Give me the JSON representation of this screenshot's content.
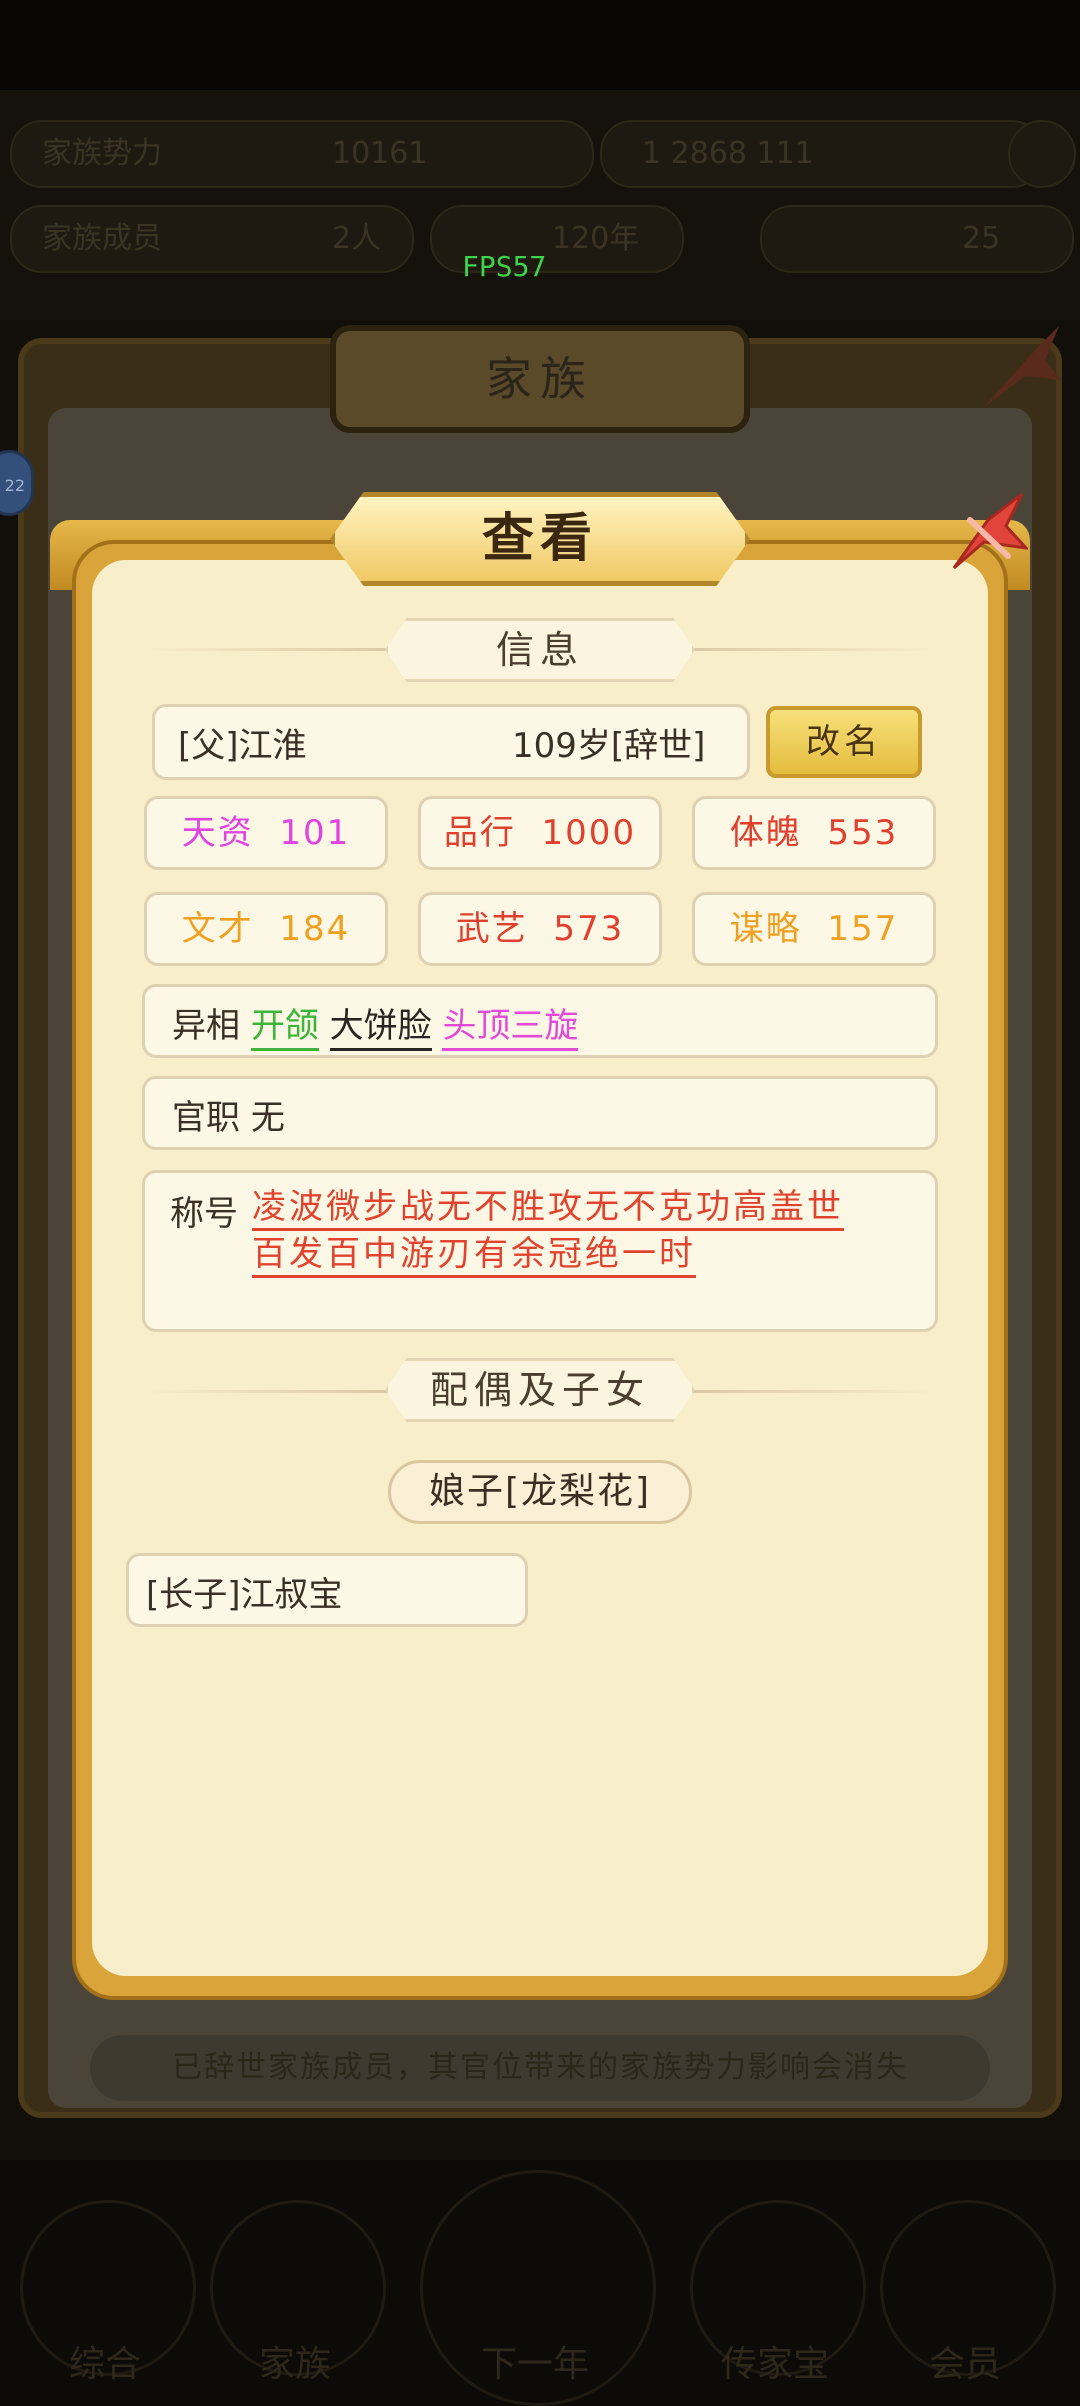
{
  "hud": {
    "row1_left": "家族势力",
    "row1_mid": "10161",
    "row1_right": "1 2868 111",
    "row2_left": "家族成员",
    "row2_mid": "2人",
    "row2_year": "120年",
    "row2_right": "25"
  },
  "fps": "FPS57",
  "back_panel": {
    "title": "家族",
    "badge": "22",
    "notice": "已辞世家族成员，其官位带来的家族势力影响会消失"
  },
  "bottom_nav": [
    "综合",
    "家族",
    "下一年",
    "传家宝",
    "会员"
  ],
  "dialog": {
    "title": "查看",
    "info_header": "信息",
    "member_name": "[父]江淮",
    "member_age": "109岁[辞世]",
    "rename_label": "改名",
    "stats": [
      {
        "label": "天资",
        "value": "101",
        "color": "#e044e0"
      },
      {
        "label": "品行",
        "value": "1000",
        "color": "#e0402e"
      },
      {
        "label": "体魄",
        "value": "553",
        "color": "#e0402e"
      },
      {
        "label": "文才",
        "value": "184",
        "color": "#f0a020"
      },
      {
        "label": "武艺",
        "value": "573",
        "color": "#e0402e"
      },
      {
        "label": "谋略",
        "value": "157",
        "color": "#f0a020"
      }
    ],
    "traits_label": "异相",
    "traits": [
      "开颌",
      "大饼脸",
      "头顶三旋"
    ],
    "office_label": "官职",
    "office_value": "无",
    "titles_label": "称号",
    "titles_line1": "凌波微步战无不胜攻无不克功高盖世",
    "titles_line2": "百发百中游刃有余冠绝一时",
    "family_header": "配偶及子女",
    "spouse": "娘子[龙梨花]",
    "child": "[长子]江叔宝"
  }
}
